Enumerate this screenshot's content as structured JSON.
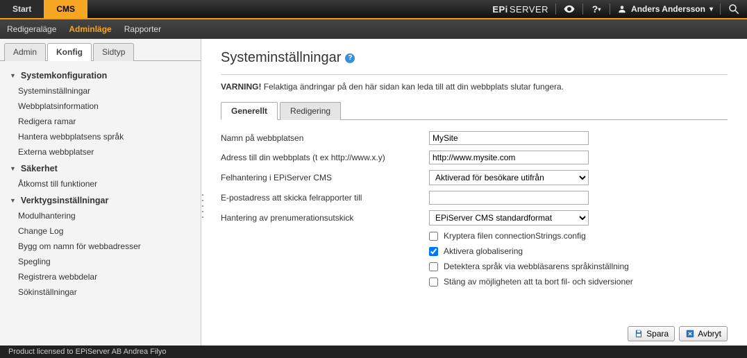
{
  "topbar": {
    "start": "Start",
    "cms": "CMS",
    "brand_bold": "EPi",
    "brand_rest": "SERVER",
    "user": "Anders Andersson"
  },
  "subbar": {
    "edit": "Redigeraläge",
    "admin": "Adminläge",
    "reports": "Rapporter"
  },
  "sidebar": {
    "tabs": {
      "admin": "Admin",
      "konfig": "Konfig",
      "sidtyp": "Sidtyp"
    },
    "group1": {
      "title": "Systemkonfiguration",
      "items": [
        "Systeminställningar",
        "Webbplatsinformation",
        "Redigera ramar",
        "Hantera webbplatsens språk",
        "Externa webbplatser"
      ]
    },
    "group2": {
      "title": "Säkerhet",
      "items": [
        "Åtkomst till funktioner"
      ]
    },
    "group3": {
      "title": "Verktygsinställningar",
      "items": [
        "Modulhantering",
        "Change Log",
        "Bygg om namn för webbadresser",
        "Spegling",
        "Registrera webbdelar",
        "Sökinställningar"
      ]
    }
  },
  "page": {
    "title": "Systeminställningar",
    "warning_bold": "VARNING!",
    "warning_rest": " Felaktiga ändringar på den här sidan kan leda till att din webbplats slutar fungera.",
    "tabs": {
      "general": "Generellt",
      "editing": "Redigering"
    },
    "labels": {
      "sitename": "Namn på webbplatsen",
      "siteurl": "Adress till din webbplats (t ex http://www.x.y)",
      "errorhandling": "Felhantering i EPiServer CMS",
      "erroremail": "E-postadress att skicka felrapporter till",
      "subscription": "Hantering av prenumerationsutskick"
    },
    "values": {
      "sitename": "MySite",
      "siteurl": "http://www.mysite.com",
      "errorhandling": "Aktiverad för besökare utifrån",
      "erroremail": "",
      "subscription": "EPiServer CMS standardformat"
    },
    "checks": {
      "encrypt": "Kryptera filen connectionStrings.config",
      "globalization": "Aktivera globalisering",
      "detectlang": "Detektera språk via webbläsarens språkinställning",
      "disabledelete": "Stäng av möjligheten att ta bort fil- och sidversioner"
    },
    "buttons": {
      "save": "Spara",
      "cancel": "Avbryt"
    }
  },
  "footer": "Product licensed to EPiServer AB Andrea Filyo"
}
